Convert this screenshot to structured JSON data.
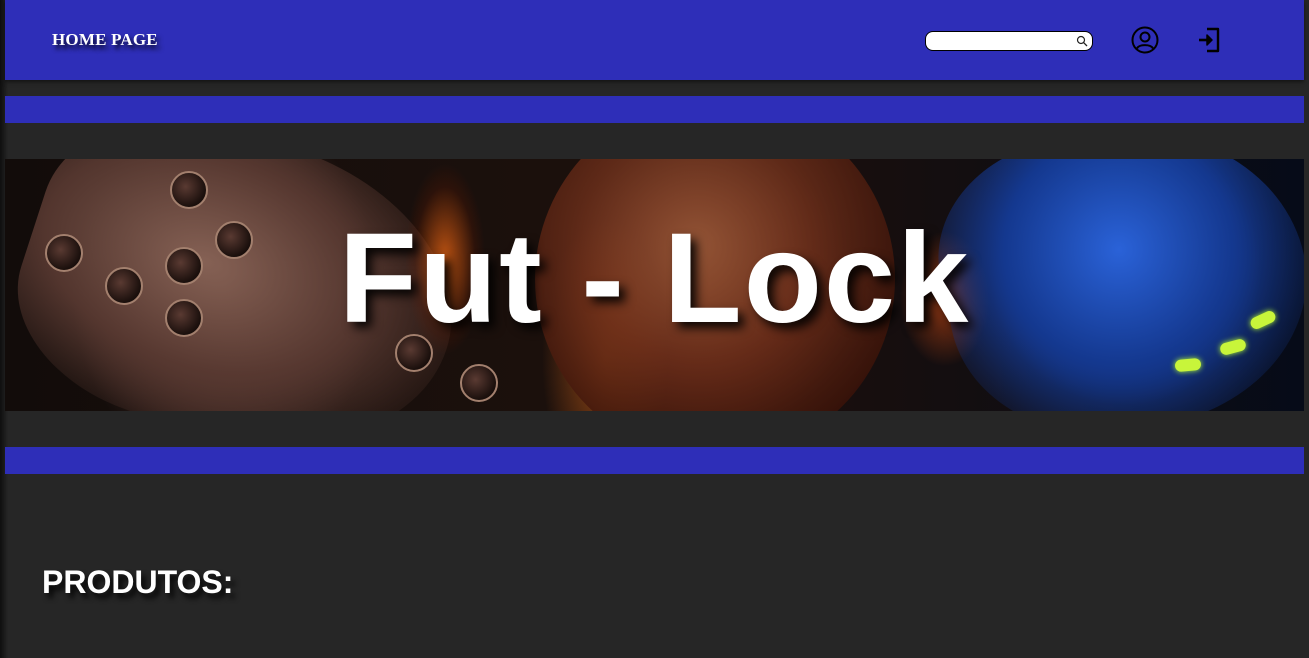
{
  "header": {
    "home_label": "HOME PAGE",
    "search": {
      "value": "",
      "placeholder": ""
    },
    "icons": {
      "search": "search-icon",
      "user": "user-circle-icon",
      "login": "login-icon"
    }
  },
  "banner": {
    "title": "Fut - Lock"
  },
  "main": {
    "section_title": "PRODUTOS:"
  },
  "colors": {
    "background": "#262626",
    "primary": "#2e2eb8",
    "text": "#ffffff"
  }
}
